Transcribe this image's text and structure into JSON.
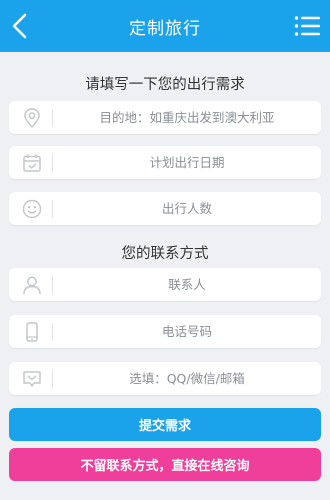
{
  "header": {
    "title": "定制旅行"
  },
  "section_needs": {
    "title": "请填写一下您的出行需求",
    "fields": [
      {
        "icon": "location-pin-icon",
        "placeholder": "目的地：如重庆出发到澳大利亚",
        "value": ""
      },
      {
        "icon": "calendar-icon",
        "placeholder": "计划出行日期",
        "value": ""
      },
      {
        "icon": "smiley-face-icon",
        "placeholder": "出行人数",
        "value": ""
      }
    ]
  },
  "section_contact": {
    "title": "您的联系方式",
    "fields": [
      {
        "icon": "person-icon",
        "placeholder": "联系人",
        "value": ""
      },
      {
        "icon": "phone-icon",
        "placeholder": "电话号码",
        "value": ""
      },
      {
        "icon": "message-icon",
        "placeholder": "选填：QQ/微信/邮箱",
        "value": ""
      }
    ]
  },
  "buttons": {
    "submit_label": "提交需求",
    "consult_label": "不留联系方式，直接在线咨询"
  },
  "colors": {
    "header": "#1aa3ea",
    "submit_button": "#1aa3ea",
    "consult_button": "#ef3f9b",
    "background": "#eef0f3",
    "icon_gray": "#c3c7cc"
  }
}
